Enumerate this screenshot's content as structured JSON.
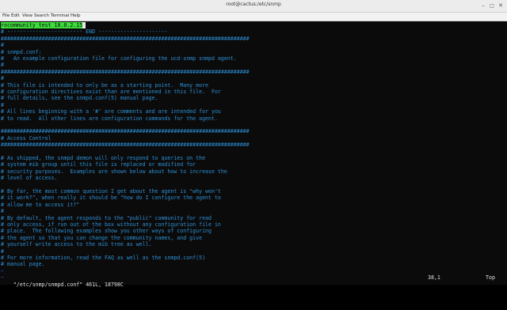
{
  "window": {
    "title": "root@cactus:/etc/snmp"
  },
  "menu": [
    "File",
    "Edit",
    "View",
    "Search",
    "Terminal",
    "Help"
  ],
  "editor": {
    "first_line_text": "rocommunity test 10.0.2.15",
    "lines": [
      "# ------------------------ END ----------------------",
      "###############################################################################",
      "#",
      "# snmpd.conf:",
      "#   An example configuration file for configuring the ucd-snmp snmpd agent.",
      "#",
      "###############################################################################",
      "#",
      "# This file is intended to only be as a starting point.  Many more",
      "# configuration directives exist than are mentioned in this file.  For",
      "# full details, see the snmpd.conf(5) manual page.",
      "#",
      "# All lines beginning with a '#' are comments and are intended for you",
      "# to read.  All other lines are configuration commands for the agent.",
      "",
      "###############################################################################",
      "# Access Control",
      "###############################################################################",
      "",
      "# As shipped, the snmpd demon will only respond to queries on the",
      "# system mib group until this file is replaced or modified for",
      "# security purposes.  Examples are shown below about how to increase the",
      "# level of access.",
      "",
      "# By far, the most common question I get about the agent is \"why won't",
      "# it work?\", when really it should be \"how do I configure the agent to",
      "# allow me to access it?\"",
      "#",
      "# By default, the agent responds to the \"public\" community for read",
      "# only access, if run out of the box without any configuration file in",
      "# place.  The following examples show you other ways of configuring",
      "# the agent so that you can change the community names, and give",
      "# yourself write access to the mib tree as well.",
      "#",
      "# For more information, read the FAQ as well as the snmpd.conf(5)",
      "# manual page."
    ],
    "tilde_lines": [
      "~",
      "~"
    ]
  },
  "status": {
    "file": "\"/etc/snmp/snmpd.conf\" 461L, 18798C",
    "position": "38,1",
    "scroll": "Top"
  },
  "colors": {
    "comment": "#2d8fd5",
    "highlight": "#3cdc3c",
    "background": "#0b0b0b",
    "tilde": "#3d4fd8"
  }
}
